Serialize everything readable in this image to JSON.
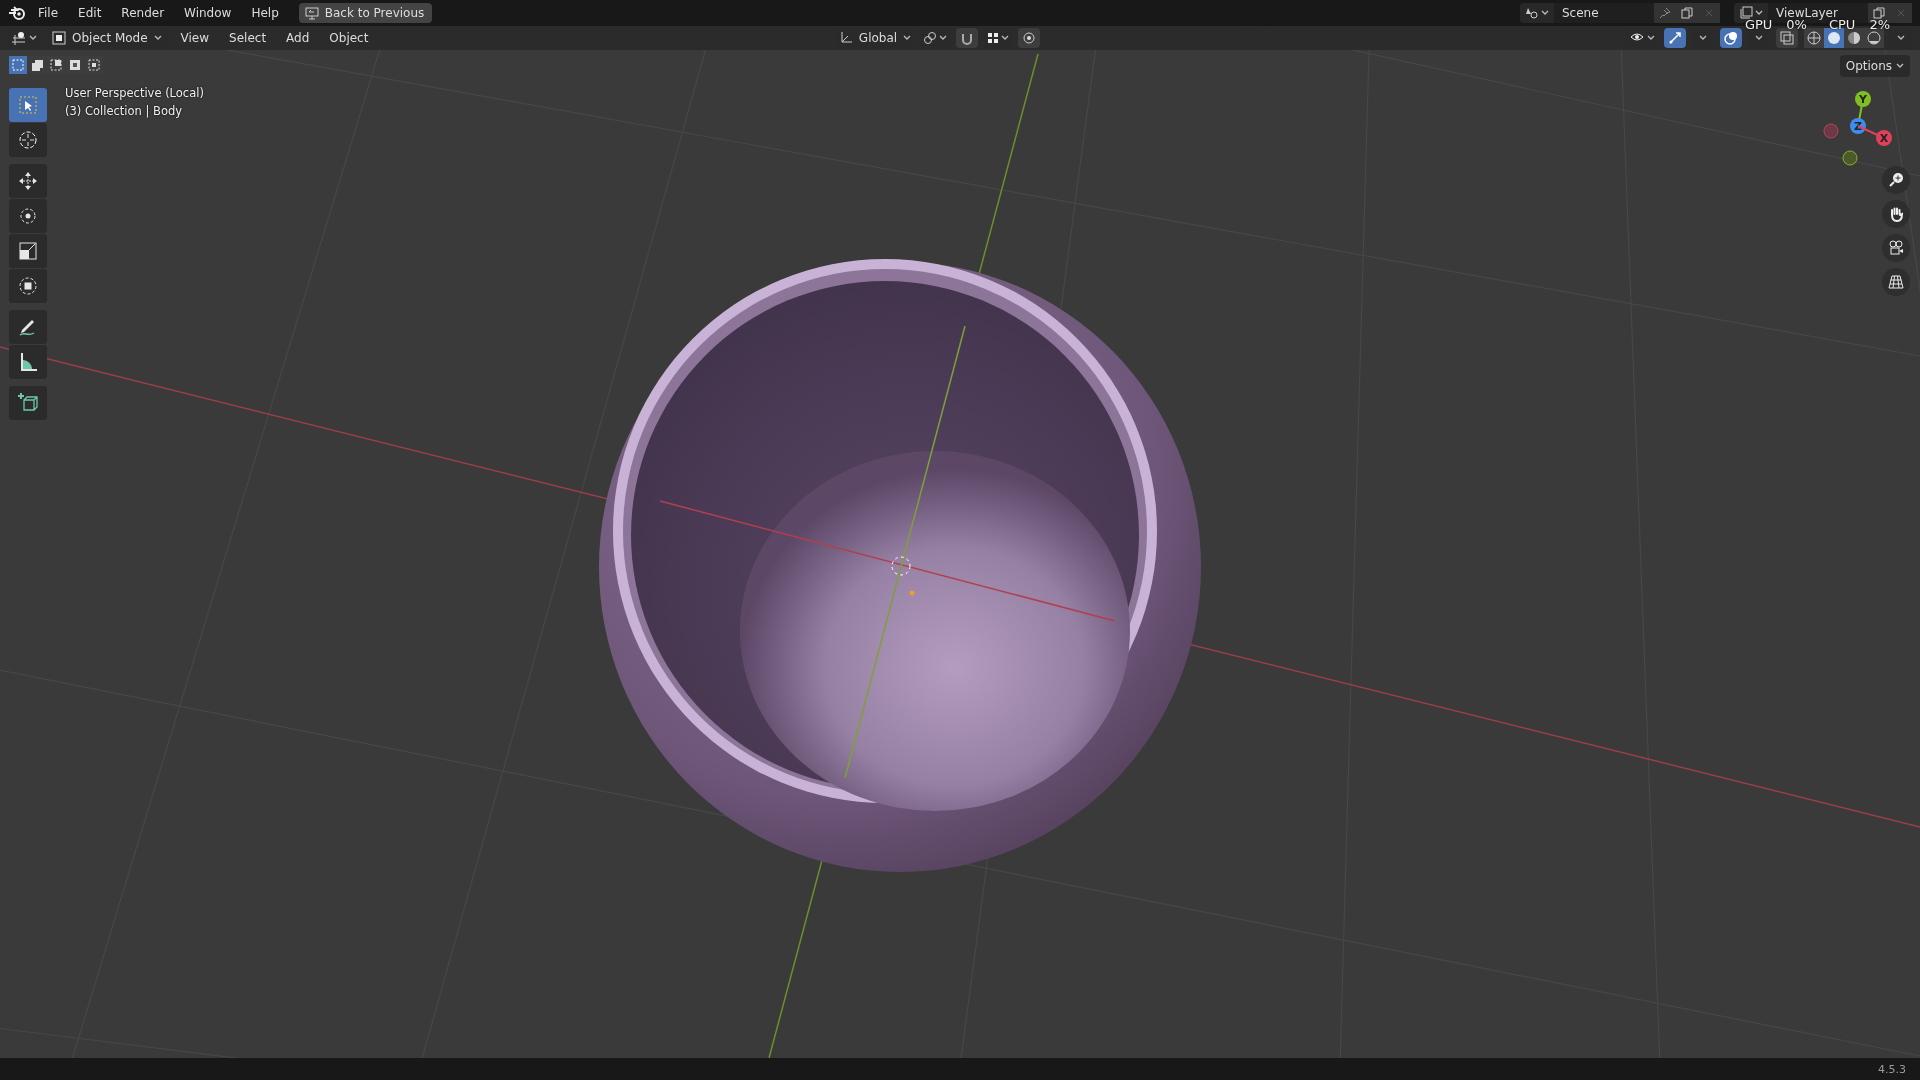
{
  "menu_bar": {
    "menus": [
      "File",
      "Edit",
      "Render",
      "Window",
      "Help"
    ],
    "back_button": "Back to Previous"
  },
  "scene": {
    "name": "Scene"
  },
  "view_layer": {
    "name": "ViewLayer"
  },
  "stats": [
    {
      "label": "GPU",
      "value": "0%"
    },
    {
      "label": "CPU",
      "value": "2%"
    }
  ],
  "header": {
    "mode": "Object Mode",
    "menus": [
      "View",
      "Select",
      "Add",
      "Object"
    ],
    "orientation": "Global"
  },
  "header_toggles": [
    {
      "kind": "snap",
      "on": false
    },
    {
      "kind": "proportional",
      "on": false
    },
    {
      "kind": "gizmos",
      "on": true
    },
    {
      "kind": "overlays",
      "on": true
    },
    {
      "kind": "xray",
      "on": false
    }
  ],
  "shading_modes": [
    {
      "kind": "wireframe",
      "selected": false
    },
    {
      "kind": "solid",
      "selected": true
    },
    {
      "kind": "material",
      "selected": false
    },
    {
      "kind": "rendered",
      "selected": false
    }
  ],
  "select_modes": [
    {
      "kind": "new",
      "selected": true
    },
    {
      "kind": "extend",
      "selected": false
    },
    {
      "kind": "subtract",
      "selected": false
    },
    {
      "kind": "invert",
      "selected": false
    },
    {
      "kind": "intersect",
      "selected": false
    }
  ],
  "options": "Options",
  "viewport": {
    "view_name": "User Perspective (Local)",
    "collection": "(3) Collection | Body"
  },
  "tools": [
    {
      "kind": "select",
      "selected": true
    },
    {
      "kind": "cursor",
      "selected": false
    },
    {
      "kind": "move",
      "selected": false
    },
    {
      "kind": "rotate",
      "selected": false
    },
    {
      "kind": "scale",
      "selected": false
    },
    {
      "kind": "transform",
      "selected": false
    },
    {
      "kind": "annotate",
      "selected": false
    },
    {
      "kind": "measure",
      "selected": false
    },
    {
      "kind": "add-cube",
      "selected": false
    }
  ],
  "axis_gizmo": [
    {
      "label": "Y",
      "color": "#7fbf20"
    },
    {
      "label": "Z",
      "color": "#3b8ef0"
    },
    {
      "label": "X",
      "color": "#e0405a"
    }
  ],
  "status_bar": {
    "version": "4.5.3"
  }
}
